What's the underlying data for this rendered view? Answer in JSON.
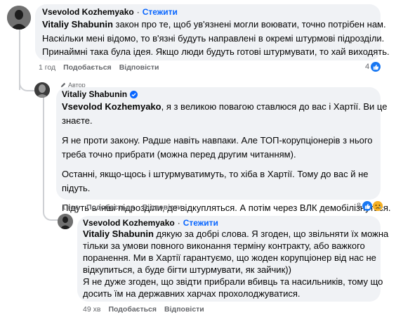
{
  "comment1": {
    "author": "Vsevolod Kozhemyako",
    "follow_label": "Стежити",
    "mention": "Vitaliy Shabunin",
    "lines": [
      "закон про те, щоб ув'язнені могли воювати, точно потрібен нам.",
      "Наскільки мені відомо, то в'язні будуть направлені в окремі штурмові підрозділи.",
      "Принаймні така була ідея. Якщо люди будуть готові штурмувати, то хай виходять."
    ],
    "time": "1 год",
    "like_label": "Подобається",
    "reply_label": "Відповісти",
    "reaction_count": "4"
  },
  "comment2": {
    "author_badge": "Автор",
    "author": "Vitaliy Shabunin",
    "mention": "Vsevolod Kozhemyako",
    "line1_rest": ", я з великою повагою ставлюся до вас і Хартії. Ви це",
    "line2": "знаєте.",
    "para2": [
      "Я не проти закону. Радше навіть навпаки. Але ТОП-корупціонерів з нього",
      "треба точно прибрати (можна перед другим читанням)."
    ],
    "para3": [
      "Останні, якщо-щось і штурмуватимуть, то хіба в Хартії. Тому до вас й не",
      "підуть."
    ],
    "para4": [
      "Підуть в інші підрозділи, де відкупляться. А потім через ВЛК демобілізнуться."
    ],
    "time": "1 год",
    "like_label": "Подобається",
    "reply_label": "Відповісти",
    "reaction_count": "8"
  },
  "comment3": {
    "author": "Vsevolod Kozhemyako",
    "follow_label": "Стежити",
    "mention": "Vitaliy Shabunin",
    "line1_rest": "дякую за добрі слова. Я згоден, що звільняти їх можна",
    "lines": [
      "тільки за умови повного виконання терміну контракту, або важкого",
      "поранення. Ми в Хартії гарантуємо, що жоден корупціонер від нас не",
      "відкупиться, а буде бігти штурмувати, як зайчик))",
      "Я не дуже згоден, що звідти прибрали вбивць та насильників, тому що",
      "досить їм на державних харчах прохолоджуватися."
    ],
    "time": "49 хв",
    "like_label": "Подобається",
    "reply_label": "Відповісти"
  }
}
